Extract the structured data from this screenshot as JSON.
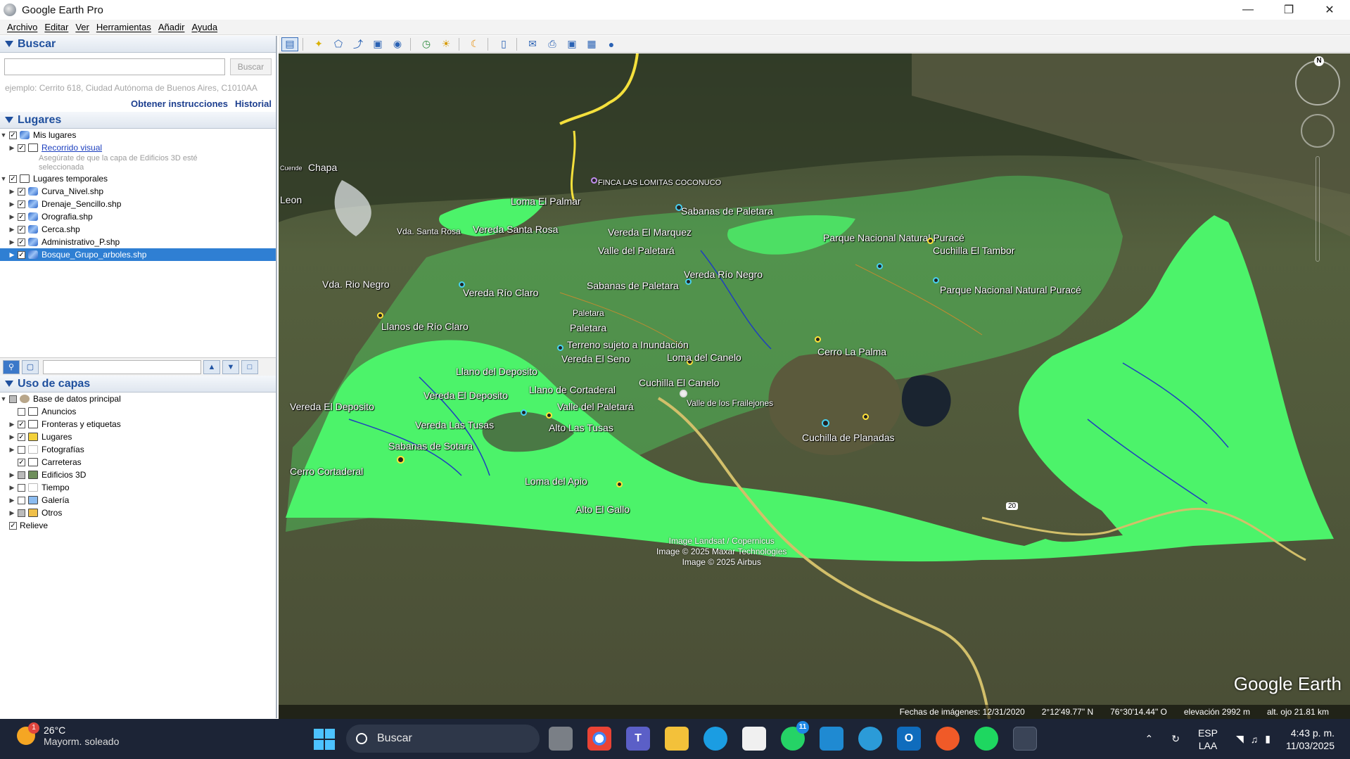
{
  "window": {
    "title": "Google Earth Pro"
  },
  "menu": [
    "Archivo",
    "Editar",
    "Ver",
    "Herramientas",
    "Añadir",
    "Ayuda"
  ],
  "search": {
    "header": "Buscar",
    "button": "Buscar",
    "example": "ejemplo: Cerrito 618, Ciudad Autónoma de Buenos Aires, C1010AA",
    "directions_link": "Obtener instrucciones",
    "history_link": "Historial"
  },
  "places": {
    "header": "Lugares",
    "my_places": "Mis lugares",
    "tour": "Recorrido visual",
    "tour_hint": "Asegúrate de que la capa de Edificios 3D esté seleccionada",
    "temp_places": "Lugares temporales",
    "layers": [
      "Curva_Nivel.shp",
      "Drenaje_Sencillo.shp",
      "Orografia.shp",
      "Cerca.shp",
      "Administrativo_P.shp",
      "Bosque_Grupo_arboles.shp"
    ]
  },
  "layers_panel": {
    "header": "Uso de capas",
    "root": "Base de datos principal",
    "items": [
      "Anuncios",
      "Fronteras y etiquetas",
      "Lugares",
      "Fotografías",
      "Carreteras",
      "Edificios 3D",
      "Tiempo",
      "Galería",
      "Otros",
      "Relieve"
    ]
  },
  "map": {
    "labels": {
      "chapa": "Chapa",
      "leon": "Leon",
      "finca": "FINCA LAS LOMITAS COCONUCO",
      "loma_palmar": "Loma El Palmar",
      "sabanas_paletara_n": "Sabanas de Paletara",
      "vda_santa_rosa": "Vda. Santa Rosa",
      "vereda_santa_rosa": "Vereda Santa Rosa",
      "vereda_marquez": "Vereda El Marquez",
      "valle_paletara": "Valle del Paletará",
      "parque_purace_1": "Parque Nacional Natural Puracé",
      "cuchilla_tambor": "Cuchilla El Tambor",
      "vereda_rio_negro": "Vereda Río Negro",
      "vda_rio_negro": "Vda. Rio Negro",
      "vereda_rio_claro": "Vereda Río Claro",
      "sabanas_paletara": "Sabanas de Paletara",
      "parque_purace_2": "Parque Nacional Natural Puracé",
      "paletara_small": "Paletara",
      "paletara": "Paletara",
      "llanos_rio_claro": "Llanos de Río Claro",
      "terreno": "Terreno sujeto a Inundación",
      "vereda_seno": "Vereda El Seno",
      "loma_canelo": "Loma del Canelo",
      "cerro_palma": "Cerro La Palma",
      "llano_deposito": "Llano del Deposito",
      "cuchilla_canelo": "Cuchilla El Canelo",
      "llano_cortaderal": "Llano de Cortaderal",
      "valle_frailejones": "Valle de los Frailejones",
      "vereda_deposito_w": "Vereda El Deposito",
      "vereda_deposito": "Vereda El Deposito",
      "valle_paletara_2": "Valle del Paletará",
      "vereda_tusas": "Vereda Las Tusas",
      "alto_tusas": "Alto Las Tusas",
      "cuchilla_planadas": "Cuchilla de Planadas",
      "sabanas_sotara": "Sabanas de Sotara",
      "cerro_cortaderal": "Cerro Cortaderal",
      "loma_apio": "Loma del Apio",
      "alto_gallo": "Alto El Gallo",
      "cuende": "Cuende",
      "road_20": "20"
    },
    "attribution": [
      "Image Landsat / Copernicus",
      "Image © 2025 Maxar Technologies",
      "Image © 2025 Airbus"
    ],
    "logo": "Google Earth",
    "compass_n": "N",
    "status": {
      "imagery_date": "Fechas de imágenes: 12/31/2020",
      "lat": "2°12'49.77\" N",
      "lon": "76°30'14.44\" O",
      "elevation": "elevación   2992 m",
      "eye_alt": "alt. ojo   21.81 km"
    }
  },
  "taskbar": {
    "weather_temp": "26°C",
    "weather_cond": "Mayorm. soleado",
    "weather_badge": "1",
    "search": "Buscar",
    "whatsapp_badge": "11",
    "lang1": "ESP",
    "lang2": "LAA",
    "time": "4:43 p. m.",
    "date": "11/03/2025"
  },
  "colors": {
    "forest_fill": "#4cf36a",
    "accent": "#1f4f9d",
    "selected": "#2f7fd3"
  }
}
